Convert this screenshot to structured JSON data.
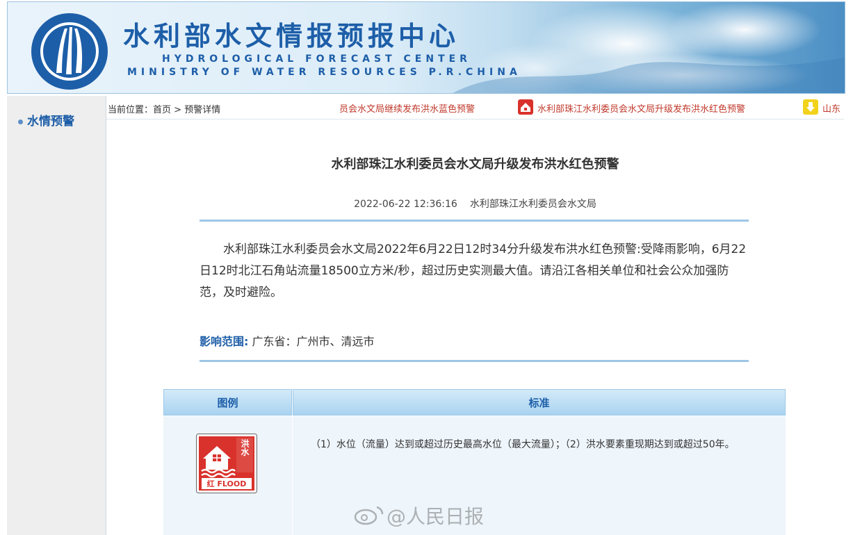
{
  "header": {
    "title_cn": "水利部水文情报预报中心",
    "title_en_line1": "HYDROLOGICAL FORECAST CENTER",
    "title_en_line2": "MINISTRY OF WATER RESOURCES P.R.CHINA"
  },
  "sidebar": {
    "items": [
      {
        "label": "水情预警",
        "icon": "bullet-dot"
      }
    ]
  },
  "breadcrumb": {
    "prefix": "当前位置：",
    "home": "首页",
    "separator": " > ",
    "current": "预警详情"
  },
  "ticker": {
    "items": [
      {
        "text": "员会水文局继续发布洪水蓝色预警",
        "icon": null
      },
      {
        "text": "水利部珠江水利委员会水文局升级发布洪水红色预警",
        "icon": "red-flood-icon"
      },
      {
        "text": "山东",
        "icon": "yellow-warning-icon"
      }
    ]
  },
  "article": {
    "title": "水利部珠江水利委员会水文局升级发布洪水红色预警",
    "datetime": "2022-06-22 12:36:16",
    "publisher": "水利部珠江水利委员会水文局",
    "body": "水利部珠江水利委员会水文局2022年6月22日12时34分升级发布洪水红色预警:受降雨影响，6月22日12时北江石角站流量18500立方米/秒，超过历史实测最大值。请沿江各相关单位和社会公众加强防范，及时避险。",
    "scope_label": "影响范围:",
    "scope_value": " 广东省：广州市、清远市"
  },
  "legend_table": {
    "col_icon": "图例",
    "col_standard": "标准",
    "rows": [
      {
        "icon": "red-flood-warning-icon",
        "icon_text_side": "洪水",
        "icon_text_bottom": "红 FLOOD",
        "standard": "（1）水位（流量）达到或超过历史最高水位（最大流量）；（2）洪水要素重现期达到或超过50年。"
      }
    ]
  },
  "watermark": {
    "text": "@人民日报"
  },
  "colors": {
    "brand_blue": "#1d5ea8",
    "warning_red": "#c0392b",
    "rule_blue": "#9fc6e7"
  }
}
